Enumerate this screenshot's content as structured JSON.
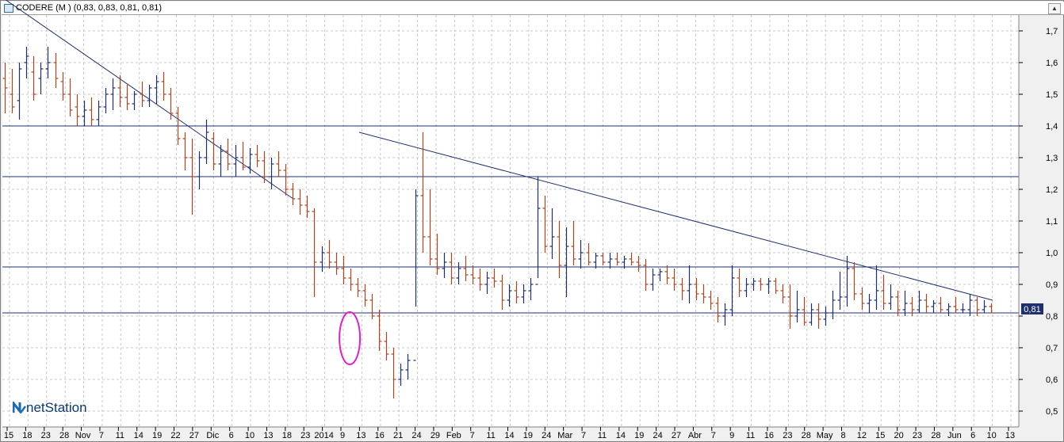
{
  "window": {
    "title": "CODERE (M ) (0,83, 0,83, 0,81, 0,81)"
  },
  "logo": {
    "text": "netStation"
  },
  "price_label": "0,81",
  "colors": {
    "up": "#1f2f6e",
    "down": "#b0441f",
    "line": "#1f2f6e",
    "grid": "#c8c8c8",
    "circle": "#e020c8"
  },
  "chart_data": {
    "type": "bar",
    "subtype": "ohlc",
    "title": "CODERE (M ) (0,83, 0,83, 0,81, 0,81)",
    "ylim": [
      0.45,
      1.75
    ],
    "y_ticks": [
      "0,5",
      "0,6",
      "0,7",
      "0,8",
      "0,9",
      "1,0",
      "1,1",
      "1,2",
      "1,3",
      "1,4",
      "1,5",
      "1,6",
      "1,7"
    ],
    "x_ticks": [
      "15",
      "18",
      "23",
      "28",
      "Nov",
      "7",
      "11",
      "14",
      "19",
      "22",
      "27",
      "Dic",
      "6",
      "10",
      "13",
      "18",
      "23",
      "2014",
      "9",
      "13",
      "16",
      "21",
      "24",
      "29",
      "Feb",
      "7",
      "11",
      "14",
      "19",
      "24",
      "Mar",
      "7",
      "11",
      "14",
      "19",
      "24",
      "27",
      "Abr",
      "7",
      "9",
      "11",
      "16",
      "23",
      "28",
      "May",
      "8",
      "12",
      "15",
      "20",
      "23",
      "28",
      "Jun",
      "6",
      "10",
      "13"
    ],
    "grid": true,
    "horizontal_levels": [
      1.4,
      1.24,
      0.955,
      0.81
    ],
    "trendlines": [
      {
        "from": [
          0,
          1.8
        ],
        "to": [
          92,
          1.17
        ]
      },
      {
        "from": [
          113,
          1.38
        ],
        "to": [
          315,
          0.85
        ]
      }
    ],
    "highlight": {
      "shape": "ellipse",
      "center": [
        110,
        0.73
      ]
    },
    "last_value": 0.81,
    "series": [
      {
        "values": [
          [
            1.55,
            1.6,
            1.44,
            1.52
          ],
          [
            1.5,
            1.58,
            1.44,
            1.46
          ],
          [
            1.48,
            1.6,
            1.42,
            1.58
          ],
          [
            1.6,
            1.65,
            1.55,
            1.62
          ],
          [
            1.57,
            1.62,
            1.48,
            1.5
          ],
          [
            1.55,
            1.6,
            1.5,
            1.58
          ],
          [
            1.58,
            1.65,
            1.55,
            1.6
          ],
          [
            1.6,
            1.63,
            1.52,
            1.55
          ],
          [
            1.54,
            1.57,
            1.48,
            1.5
          ],
          [
            1.5,
            1.55,
            1.43,
            1.45
          ],
          [
            1.46,
            1.5,
            1.4,
            1.43
          ],
          [
            1.43,
            1.48,
            1.4,
            1.45
          ],
          [
            1.45,
            1.49,
            1.4,
            1.42
          ],
          [
            1.42,
            1.48,
            1.4,
            1.46
          ],
          [
            1.46,
            1.52,
            1.44,
            1.5
          ],
          [
            1.5,
            1.55,
            1.45,
            1.52
          ],
          [
            1.52,
            1.56,
            1.46,
            1.49
          ],
          [
            1.49,
            1.53,
            1.45,
            1.47
          ],
          [
            1.47,
            1.51,
            1.45,
            1.5
          ],
          [
            1.5,
            1.54,
            1.46,
            1.48
          ],
          [
            1.48,
            1.53,
            1.46,
            1.52
          ],
          [
            1.52,
            1.56,
            1.47,
            1.54
          ],
          [
            1.54,
            1.57,
            1.48,
            1.5
          ],
          [
            1.5,
            1.52,
            1.42,
            1.44
          ],
          [
            1.44,
            1.46,
            1.34,
            1.36
          ],
          [
            1.36,
            1.38,
            1.26,
            1.3
          ],
          [
            1.3,
            1.36,
            1.12,
            1.24
          ],
          [
            1.24,
            1.32,
            1.2,
            1.3
          ],
          [
            1.3,
            1.42,
            1.28,
            1.38
          ],
          [
            1.36,
            1.38,
            1.26,
            1.28
          ],
          [
            1.28,
            1.34,
            1.24,
            1.32
          ],
          [
            1.32,
            1.36,
            1.26,
            1.28
          ],
          [
            1.28,
            1.34,
            1.24,
            1.3
          ],
          [
            1.3,
            1.35,
            1.26,
            1.27
          ],
          [
            1.27,
            1.33,
            1.25,
            1.31
          ],
          [
            1.31,
            1.34,
            1.27,
            1.29
          ],
          [
            1.29,
            1.32,
            1.22,
            1.24
          ],
          [
            1.24,
            1.3,
            1.2,
            1.28
          ],
          [
            1.28,
            1.32,
            1.24,
            1.26
          ],
          [
            1.26,
            1.28,
            1.18,
            1.2
          ],
          [
            1.2,
            1.22,
            1.15,
            1.17
          ],
          [
            1.17,
            1.2,
            1.12,
            1.15
          ],
          [
            1.15,
            1.18,
            1.11,
            1.13
          ],
          [
            1.13,
            1.14,
            0.86,
            0.97
          ],
          [
            0.97,
            1.02,
            0.94,
            1.0
          ],
          [
            1.0,
            1.04,
            0.95,
            0.97
          ],
          [
            0.97,
            1.0,
            0.93,
            0.95
          ],
          [
            0.95,
            0.99,
            0.9,
            0.92
          ],
          [
            0.92,
            0.95,
            0.88,
            0.9
          ],
          [
            0.9,
            0.92,
            0.86,
            0.88
          ],
          [
            0.88,
            0.9,
            0.83,
            0.85
          ],
          [
            0.85,
            0.87,
            0.79,
            0.8
          ],
          [
            0.8,
            0.82,
            0.69,
            0.72
          ],
          [
            0.72,
            0.75,
            0.66,
            0.68
          ],
          [
            0.68,
            0.7,
            0.54,
            0.6
          ],
          [
            0.6,
            0.65,
            0.58,
            0.63
          ],
          [
            0.63,
            0.68,
            0.6,
            0.66
          ],
          [
            0.66,
            1.2,
            0.83,
            1.18
          ],
          [
            1.18,
            1.38,
            1.0,
            1.05
          ],
          [
            1.05,
            1.2,
            0.96,
            0.98
          ],
          [
            0.98,
            1.06,
            0.93,
            0.95
          ],
          [
            0.95,
            1.0,
            0.92,
            0.97
          ],
          [
            0.97,
            1.0,
            0.9,
            0.92
          ],
          [
            0.92,
            0.97,
            0.9,
            0.95
          ],
          [
            0.95,
            0.99,
            0.91,
            0.93
          ],
          [
            0.93,
            0.96,
            0.9,
            0.92
          ],
          [
            0.92,
            0.95,
            0.88,
            0.9
          ],
          [
            0.9,
            0.94,
            0.87,
            0.92
          ],
          [
            0.92,
            0.95,
            0.89,
            0.91
          ],
          [
            0.91,
            0.93,
            0.82,
            0.85
          ],
          [
            0.85,
            0.9,
            0.83,
            0.88
          ],
          [
            0.88,
            0.91,
            0.84,
            0.86
          ],
          [
            0.86,
            0.9,
            0.84,
            0.88
          ],
          [
            0.88,
            0.92,
            0.85,
            0.9
          ],
          [
            0.9,
            1.24,
            0.92,
            1.14
          ],
          [
            1.14,
            1.18,
            1.0,
            1.02
          ],
          [
            1.02,
            1.14,
            0.98,
            1.05
          ],
          [
            1.05,
            1.1,
            0.92,
            0.96
          ],
          [
            0.96,
            1.08,
            0.86,
            1.02
          ],
          [
            1.02,
            1.1,
            0.96,
            0.98
          ],
          [
            0.98,
            1.04,
            0.95,
            1.0
          ],
          [
            1.0,
            1.03,
            0.96,
            0.97
          ],
          [
            0.97,
            1.0,
            0.95,
            0.99
          ],
          [
            0.99,
            1.0,
            0.96,
            0.97
          ],
          [
            0.97,
            1.0,
            0.95,
            0.98
          ],
          [
            0.98,
            1.0,
            0.96,
            0.97
          ],
          [
            0.97,
            0.99,
            0.95,
            0.98
          ],
          [
            0.98,
            1.0,
            0.96,
            0.97
          ],
          [
            0.97,
            0.99,
            0.94,
            0.96
          ],
          [
            0.96,
            0.98,
            0.88,
            0.9
          ],
          [
            0.9,
            0.95,
            0.88,
            0.93
          ],
          [
            0.93,
            0.95,
            0.91,
            0.94
          ],
          [
            0.94,
            0.96,
            0.9,
            0.92
          ],
          [
            0.92,
            0.95,
            0.88,
            0.9
          ],
          [
            0.9,
            0.92,
            0.85,
            0.88
          ],
          [
            0.88,
            0.96,
            0.84,
            0.9
          ],
          [
            0.9,
            0.92,
            0.85,
            0.87
          ],
          [
            0.87,
            0.9,
            0.84,
            0.86
          ],
          [
            0.86,
            0.88,
            0.82,
            0.84
          ],
          [
            0.84,
            0.86,
            0.78,
            0.8
          ],
          [
            0.8,
            0.84,
            0.77,
            0.82
          ],
          [
            0.82,
            0.96,
            0.8,
            0.92
          ],
          [
            0.92,
            0.95,
            0.86,
            0.88
          ],
          [
            0.88,
            0.92,
            0.86,
            0.9
          ],
          [
            0.9,
            0.92,
            0.88,
            0.91
          ],
          [
            0.91,
            0.92,
            0.88,
            0.9
          ],
          [
            0.9,
            0.92,
            0.87,
            0.91
          ],
          [
            0.91,
            0.92,
            0.87,
            0.88
          ],
          [
            0.88,
            0.9,
            0.84,
            0.86
          ],
          [
            0.86,
            0.9,
            0.76,
            0.8
          ],
          [
            0.8,
            0.88,
            0.78,
            0.82
          ],
          [
            0.82,
            0.86,
            0.77,
            0.78
          ],
          [
            0.78,
            0.84,
            0.77,
            0.82
          ],
          [
            0.82,
            0.84,
            0.76,
            0.79
          ],
          [
            0.79,
            0.83,
            0.77,
            0.81
          ],
          [
            0.81,
            0.88,
            0.79,
            0.85
          ],
          [
            0.85,
            0.94,
            0.82,
            0.86
          ],
          [
            0.86,
            0.99,
            0.83,
            0.95
          ],
          [
            0.95,
            0.97,
            0.85,
            0.87
          ],
          [
            0.87,
            0.89,
            0.82,
            0.84
          ],
          [
            0.84,
            0.87,
            0.81,
            0.85
          ],
          [
            0.85,
            0.96,
            0.82,
            0.88
          ],
          [
            0.88,
            0.93,
            0.82,
            0.84
          ],
          [
            0.84,
            0.9,
            0.82,
            0.86
          ],
          [
            0.86,
            0.88,
            0.8,
            0.82
          ],
          [
            0.82,
            0.88,
            0.8,
            0.84
          ],
          [
            0.84,
            0.86,
            0.8,
            0.82
          ],
          [
            0.82,
            0.88,
            0.81,
            0.85
          ],
          [
            0.85,
            0.87,
            0.81,
            0.83
          ],
          [
            0.83,
            0.85,
            0.81,
            0.84
          ],
          [
            0.84,
            0.86,
            0.81,
            0.82
          ],
          [
            0.82,
            0.84,
            0.8,
            0.83
          ],
          [
            0.83,
            0.86,
            0.81,
            0.82
          ],
          [
            0.82,
            0.84,
            0.81,
            0.82
          ],
          [
            0.82,
            0.87,
            0.8,
            0.85
          ],
          [
            0.85,
            0.86,
            0.8,
            0.82
          ],
          [
            0.82,
            0.85,
            0.81,
            0.83
          ],
          [
            0.83,
            0.84,
            0.81,
            0.81
          ]
        ]
      }
    ]
  }
}
